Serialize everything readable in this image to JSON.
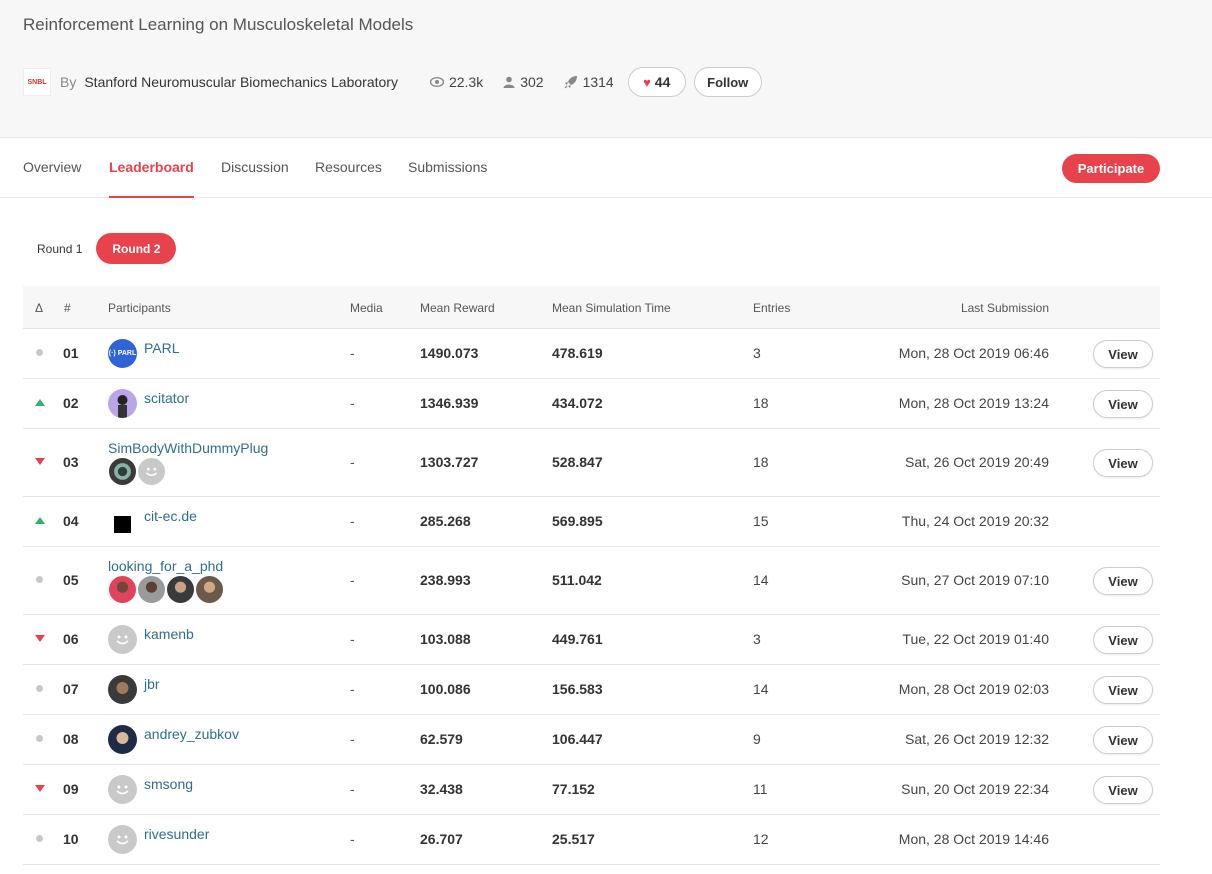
{
  "header": {
    "title": "Reinforcement Learning on Musculoskeletal Models",
    "by_label": "By",
    "organizer": "Stanford Neuromuscular Biomechanics Laboratory",
    "views": "22.3k",
    "participants": "302",
    "submissions": "1314",
    "likes": "44",
    "follow_label": "Follow"
  },
  "tabs": {
    "overview": "Overview",
    "leaderboard": "Leaderboard",
    "discussion": "Discussion",
    "resources": "Resources",
    "submissions": "Submissions"
  },
  "participate_label": "Participate",
  "rounds": {
    "round1": "Round 1",
    "round2": "Round 2"
  },
  "table": {
    "headers": {
      "delta": "Δ",
      "rank": "#",
      "participants": "Participants",
      "media": "Media",
      "mean_reward": "Mean Reward",
      "mean_sim_time": "Mean Simulation Time",
      "entries": "Entries",
      "last_submission": "Last Submission"
    },
    "view_label": "View",
    "rows": [
      {
        "rank": "01",
        "name": "PARL",
        "media": "-",
        "reward": "1490.073",
        "simtime": "478.619",
        "entries": "3",
        "last": "Mon, 28 Oct 2019 06:46"
      },
      {
        "rank": "02",
        "name": "scitator",
        "media": "-",
        "reward": "1346.939",
        "simtime": "434.072",
        "entries": "18",
        "last": "Mon, 28 Oct 2019 13:24"
      },
      {
        "rank": "03",
        "name": "SimBodyWithDummyPlug",
        "media": "-",
        "reward": "1303.727",
        "simtime": "528.847",
        "entries": "18",
        "last": "Sat, 26 Oct 2019 20:49"
      },
      {
        "rank": "04",
        "name": "cit-ec.de",
        "media": "-",
        "reward": "285.268",
        "simtime": "569.895",
        "entries": "15",
        "last": "Thu, 24 Oct 2019 20:32"
      },
      {
        "rank": "05",
        "name": "looking_for_a_phd",
        "media": "-",
        "reward": "238.993",
        "simtime": "511.042",
        "entries": "14",
        "last": "Sun, 27 Oct 2019 07:10"
      },
      {
        "rank": "06",
        "name": "kamenb",
        "media": "-",
        "reward": "103.088",
        "simtime": "449.761",
        "entries": "3",
        "last": "Tue, 22 Oct 2019 01:40"
      },
      {
        "rank": "07",
        "name": "jbr",
        "media": "-",
        "reward": "100.086",
        "simtime": "156.583",
        "entries": "14",
        "last": "Mon, 28 Oct 2019 02:03"
      },
      {
        "rank": "08",
        "name": "andrey_zubkov",
        "media": "-",
        "reward": "62.579",
        "simtime": "106.447",
        "entries": "9",
        "last": "Sat, 26 Oct 2019 12:32"
      },
      {
        "rank": "09",
        "name": "smsong",
        "media": "-",
        "reward": "32.438",
        "simtime": "77.152",
        "entries": "11",
        "last": "Sun, 20 Oct 2019 22:34"
      },
      {
        "rank": "10",
        "name": "rivesunder",
        "media": "-",
        "reward": "26.707",
        "simtime": "25.517",
        "entries": "12",
        "last": "Mon, 28 Oct 2019 14:46"
      }
    ]
  },
  "colors": {
    "accent": "#e8434d",
    "up": "#2fb36a",
    "link": "#2e6f8e"
  }
}
